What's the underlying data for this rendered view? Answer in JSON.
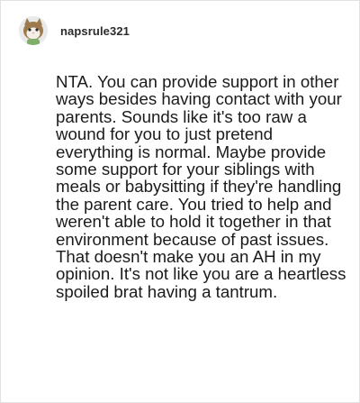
{
  "comment": {
    "username": "napsrule321",
    "avatar_icon": "cat-avatar-icon",
    "text": "NTA. You can provide support in other ways besides having contact with your parents. Sounds like it's too raw a wound for you to just pretend everything is normal. Maybe provide some support for your siblings with meals or babysitting if they're handling the parent care. You tried to help and weren't able to hold it together in that environment because of past issues. That doesn't make you an AH in my opinion. It's not like you are a heartless spoiled brat having a tantrum."
  },
  "colors": {
    "avatar_fur": "#9c7a4e",
    "avatar_face": "#f4efe6",
    "avatar_bg": "#e9e9e9",
    "text": "#1b1b1b",
    "border": "#e2e2e2"
  }
}
